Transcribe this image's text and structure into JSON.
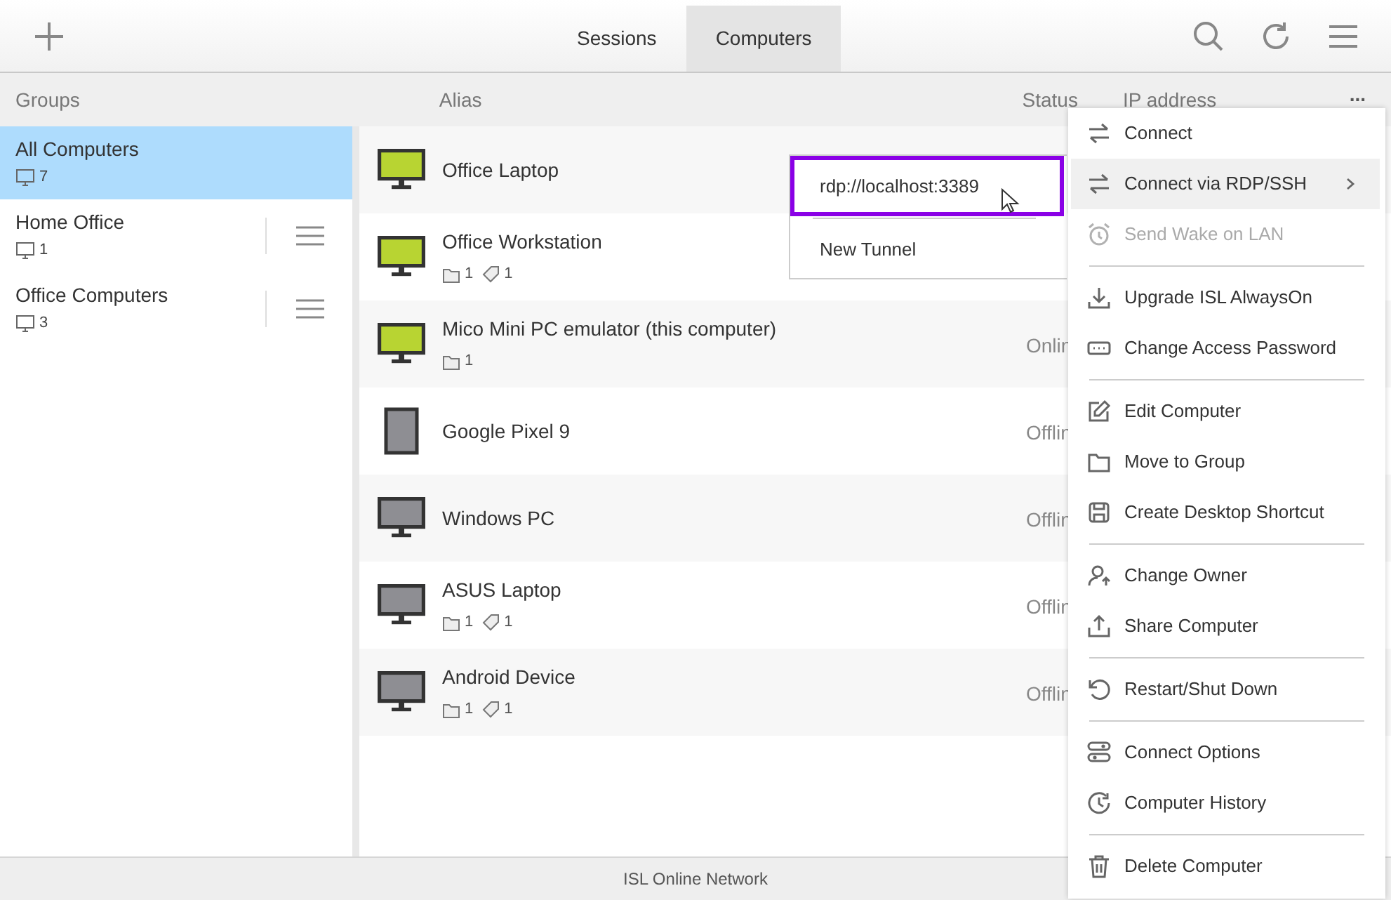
{
  "tabs": [
    {
      "label": "Sessions",
      "selected": false
    },
    {
      "label": "Computers",
      "selected": true
    }
  ],
  "columns": {
    "groups": "Groups",
    "alias": "Alias",
    "status": "Status",
    "ip": "IP address",
    "more": "..."
  },
  "groups": [
    {
      "name": "All Computers",
      "count": "7",
      "selected": true,
      "menu": false
    },
    {
      "name": "Home Office",
      "count": "1",
      "selected": false,
      "menu": true
    },
    {
      "name": "Office Computers",
      "count": "3",
      "selected": false,
      "menu": true
    }
  ],
  "computers": [
    {
      "name": "Office Laptop",
      "kind": "monitor",
      "online": true
    },
    {
      "name": "Office Workstation",
      "kind": "monitor",
      "online": true,
      "folders": "1",
      "tags": "1"
    },
    {
      "name": "Mico Mini PC emulator (this computer)",
      "kind": "monitor",
      "online": true,
      "folders": "1",
      "status": "Onlin"
    },
    {
      "name": "Google Pixel 9",
      "kind": "phone",
      "online": false,
      "status": "Offlin"
    },
    {
      "name": "Windows PC",
      "kind": "monitor",
      "online": false,
      "status": "Offlin"
    },
    {
      "name": "ASUS Laptop",
      "kind": "monitor",
      "online": false,
      "folders": "1",
      "tags": "1",
      "status": "Offlin"
    },
    {
      "name": "Android Device",
      "kind": "monitor",
      "online": false,
      "folders": "1",
      "tags": "1",
      "status": "Offlin"
    }
  ],
  "submenu": {
    "items": [
      {
        "label": "rdp://localhost:3389",
        "selected": true
      },
      {
        "label": "New Tunnel",
        "selected": false
      }
    ]
  },
  "context_menu": {
    "sections": [
      [
        {
          "label": "Connect",
          "disabled": false,
          "selected": false,
          "submenu": false
        },
        {
          "label": "Connect via RDP/SSH",
          "disabled": false,
          "selected": true,
          "submenu": true
        },
        {
          "label": "Send Wake on LAN",
          "disabled": true,
          "selected": false,
          "submenu": false
        }
      ],
      [
        {
          "label": "Upgrade ISL AlwaysOn",
          "disabled": false,
          "selected": false,
          "submenu": false
        },
        {
          "label": "Change Access Password",
          "disabled": false,
          "selected": false,
          "submenu": false
        }
      ],
      [
        {
          "label": "Edit Computer",
          "disabled": false,
          "selected": false,
          "submenu": false
        },
        {
          "label": "Move to Group",
          "disabled": false,
          "selected": false,
          "submenu": false
        },
        {
          "label": "Create Desktop Shortcut",
          "disabled": false,
          "selected": false,
          "submenu": false
        }
      ],
      [
        {
          "label": "Change Owner",
          "disabled": false,
          "selected": false,
          "submenu": false
        },
        {
          "label": "Share Computer",
          "disabled": false,
          "selected": false,
          "submenu": false
        }
      ],
      [
        {
          "label": "Restart/Shut Down",
          "disabled": false,
          "selected": false,
          "submenu": false
        }
      ],
      [
        {
          "label": "Connect Options",
          "disabled": false,
          "selected": false,
          "submenu": false
        },
        {
          "label": "Computer History",
          "disabled": false,
          "selected": false,
          "submenu": false
        }
      ],
      [
        {
          "label": "Delete Computer",
          "disabled": false,
          "selected": false,
          "submenu": false
        }
      ]
    ]
  },
  "status_bar": "ISL Online Network"
}
